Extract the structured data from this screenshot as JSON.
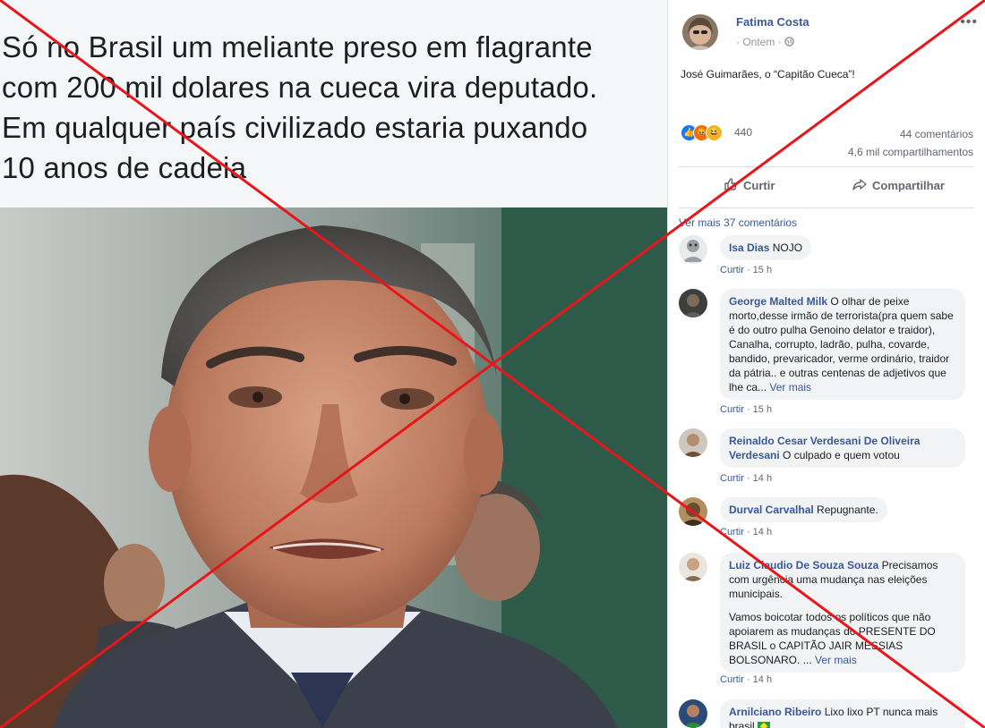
{
  "caption": {
    "lines": [
      "Só no Brasil um meliante preso em flagrante",
      "com 200 mil dolares na cueca vira deputado.",
      "Em qualquer país civilizado estaria puxando",
      "10 anos de cadeia"
    ]
  },
  "post": {
    "author": "Fatima Costa",
    "time": "· Ontem ·",
    "text": "José Guimarães, o “Capitão Cueca”!",
    "reaction_count": "440",
    "comments_count": "44 comentários",
    "shares_count": "4,6 mil compartilhamentos",
    "actions": {
      "like": "Curtir",
      "share": "Compartilhar"
    }
  },
  "see_more": "Ver mais 37 comentários",
  "comments": [
    {
      "name": "Isa Dias",
      "text": " NOJO",
      "more": "",
      "like_label": "Curtir",
      "time": " · 15 h"
    },
    {
      "name": "George Malted Milk",
      "text": " O olhar de peixe morto,desse irmão de terrorista(pra quem sabe é do outro pulha Genoino delator e traidor), Canalha, corrupto, ladrão, pulha, covarde, bandido, prevaricador, verme ordinário, traidor da pátria.. e outras centenas de adjetivos que lhe ca... ",
      "more": "Ver mais",
      "like_label": "Curtir",
      "time": " · 15 h"
    },
    {
      "name": "Reinaldo Cesar Verdesani De Oliveira Verdesani",
      "text": " O culpado e quem votou",
      "more": "",
      "like_label": "Curtir",
      "time": " · 14 h"
    },
    {
      "name": "Durval Carvalhal",
      "text": " Repugnante.",
      "more": "",
      "like_label": "Curtir",
      "time": " · 14 h"
    },
    {
      "name": "Luiz Claudio De Souza Souza",
      "text": " Precisamos com urgência uma mudança nas eleições municipais.",
      "text2": "Vamos boicotar todos os políticos que não apoiarem as mudanças do PRESENTE DO BRASIL o CAPITÃO JAIR MESSIAS BOLSONARO. ... ",
      "more": "Ver mais",
      "like_label": "Curtir",
      "time": " · 14 h"
    },
    {
      "name": "Arnilciano Ribeiro",
      "text": " Lixo lixo PT nunca mais brasil",
      "more": "",
      "like_label": "",
      "time": ""
    }
  ],
  "colors": {
    "link": "#385898",
    "overlay_x": "#e8151b",
    "bubble": "#f2f3f5"
  }
}
